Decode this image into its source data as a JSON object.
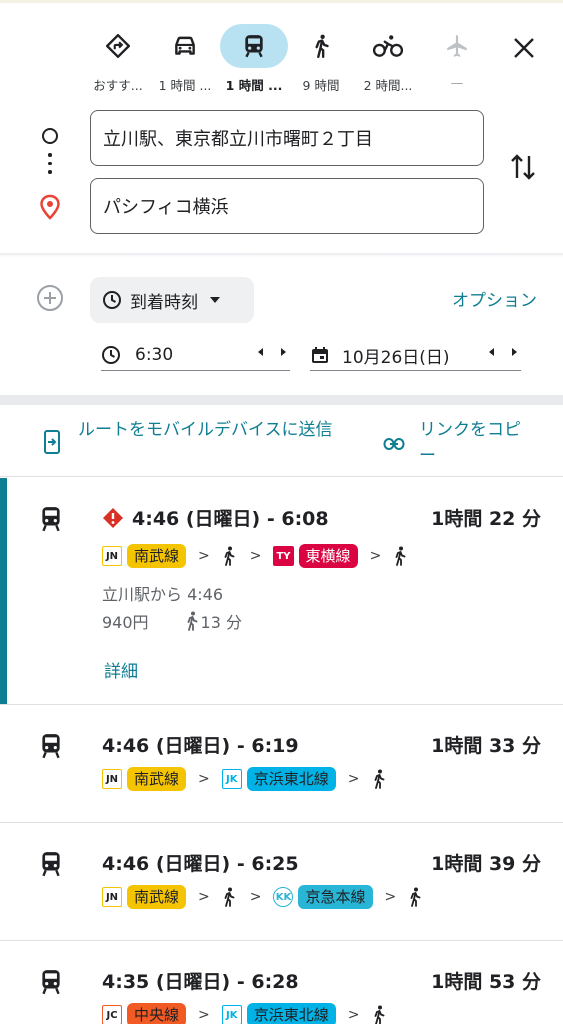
{
  "modes": [
    {
      "label": "おすす...",
      "icon": "recommended-diamond-icon"
    },
    {
      "label": "1 時間 ...",
      "icon": "car-icon"
    },
    {
      "label": "1 時間 ...",
      "icon": "transit-icon"
    },
    {
      "label": "9 時間",
      "icon": "walking-icon"
    },
    {
      "label": "2 時間...",
      "icon": "bicycle-icon"
    },
    {
      "label": "—",
      "icon": "airplane-icon"
    }
  ],
  "origin": "立川駅、東京都立川市曙町２丁目",
  "destination": "パシフィコ横浜",
  "arrive_label": "到着時刻",
  "options_label": "オプション",
  "time": "6:30",
  "date": "10月26日(日)",
  "send_label": "ルートをモバイルデバイスに送信",
  "copy_label": "リンクをコピー",
  "routes": [
    {
      "time": "4:46 (日曜日) - 6:08",
      "duration": "1時間 22 分",
      "warning": true,
      "from": "立川駅から 4:46",
      "fare": "940円",
      "walk": "13 分",
      "detail": "詳細"
    },
    {
      "time": "4:46 (日曜日) - 6:19",
      "duration": "1時間 33 分"
    },
    {
      "time": "4:46 (日曜日) - 6:25",
      "duration": "1時間 39 分"
    },
    {
      "time": "4:35 (日曜日) - 6:28",
      "duration": "1時間 53 分"
    }
  ],
  "lines": {
    "JN": {
      "code": "JN",
      "name": "南武線",
      "color": "#f5c400"
    },
    "TY": {
      "code": "TY",
      "name": "東横線",
      "color": "#da0442"
    },
    "JK": {
      "code": "JK",
      "name": "京浜東北線",
      "color": "#00b2e5"
    },
    "KK": {
      "code": "KK",
      "name": "京急本線",
      "color": "#29b6d6"
    },
    "JC": {
      "code": "JC",
      "name": "中央線",
      "color": "#f15a22"
    }
  }
}
